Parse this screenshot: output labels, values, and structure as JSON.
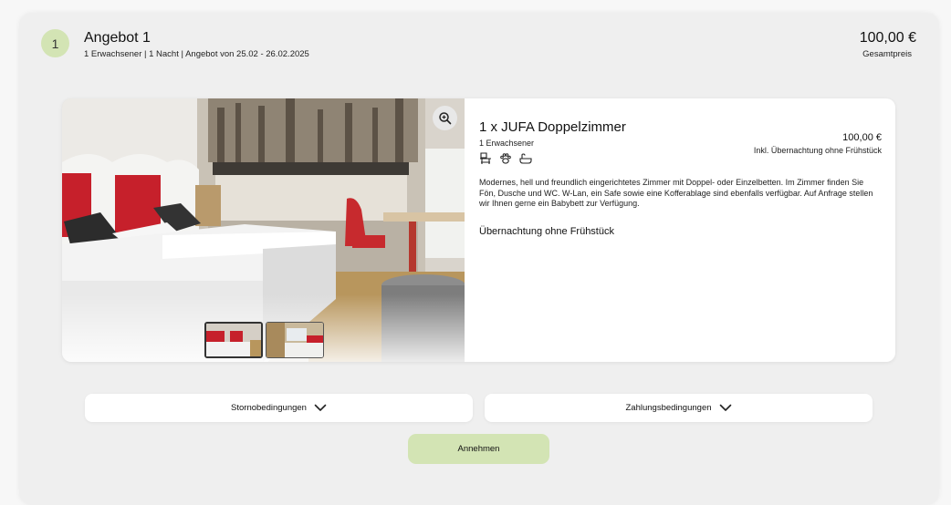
{
  "offer": {
    "step": "1",
    "title": "Angebot 1",
    "subtitle": "1 Erwachsener | 1 Nacht | Angebot von 25.02 - 26.02.2025",
    "total_price": "100,00 €",
    "total_label": "Gesamtpreis"
  },
  "room": {
    "name": "1 x JUFA Doppelzimmer",
    "occupancy": "1 Erwachsener",
    "price": "100,00 €",
    "rate": "Inkl. Übernachtung ohne Frühstück",
    "description": "Modernes, hell und freundlich eingerichtetes Zimmer mit Doppel- oder Einzelbetten. Im Zimmer finden Sie Fön, Dusche und WC. W-Lan, ein Safe sowie eine Kofferablage sind ebenfalls verfügbar. Auf Anfrage stellen wir Ihnen gerne ein Babybett zur Verfügung.",
    "meal": "Übernachtung ohne Frühstück",
    "amenity_icons": [
      "desk-icon",
      "pet-paw-icon",
      "bathtub-icon"
    ],
    "thumbnail_count": 2
  },
  "footer": {
    "storno_label": "Stornobedingungen",
    "payment_label": "Zahlungsbedingungen",
    "accept_label": "Annehmen"
  },
  "colors": {
    "accent_green": "#d3e4b4",
    "panel_bg": "#efefef",
    "card_bg": "#ffffff"
  }
}
